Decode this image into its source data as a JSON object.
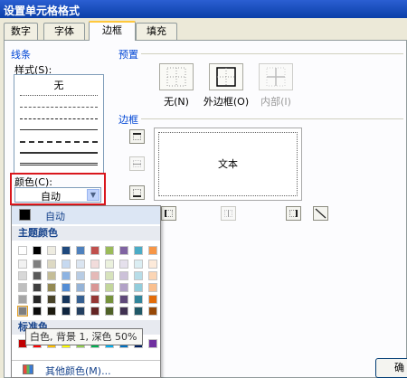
{
  "window": {
    "title": "设置单元格格式"
  },
  "tabs": [
    {
      "label": "数字",
      "active": false
    },
    {
      "label": "字体",
      "active": false
    },
    {
      "label": "边框",
      "active": true
    },
    {
      "label": "填充",
      "active": false
    }
  ],
  "line_section": {
    "label": "线条",
    "style_label": "样式(S):",
    "none_label": "无",
    "color_label": "颜色(C):",
    "color_value": "自动"
  },
  "preset_section": {
    "label": "预置",
    "buttons": [
      {
        "label": "无(N)",
        "icon": "no-border-icon",
        "enabled": true
      },
      {
        "label": "外边框(O)",
        "icon": "outline-border-icon",
        "enabled": true
      },
      {
        "label": "内部(I)",
        "icon": "inside-border-icon",
        "enabled": false
      }
    ]
  },
  "border_section": {
    "label": "边框",
    "preview_text": "文本"
  },
  "ok_button": "确",
  "color_palette": {
    "automatic_label": "自动",
    "automatic_color": "#000000",
    "theme_colors_label": "主题颜色",
    "theme_colors": [
      [
        "#FFFFFF",
        "#000000",
        "#EEECE1",
        "#1F497D",
        "#4F81BD",
        "#C0504D",
        "#9BBB59",
        "#8064A2",
        "#4BACC6",
        "#F79646"
      ],
      [
        "#F2F2F2",
        "#7F7F7F",
        "#DDD9C3",
        "#C6D9F0",
        "#DBE5F1",
        "#F2DCDB",
        "#EBF1DD",
        "#E5E0EC",
        "#DBEEF3",
        "#FDEADA"
      ],
      [
        "#D8D8D8",
        "#595959",
        "#C4BD97",
        "#8DB3E2",
        "#B8CCE4",
        "#E5B9B7",
        "#D7E3BC",
        "#CCC1D9",
        "#B7DDE8",
        "#FBD5B5"
      ],
      [
        "#BFBFBF",
        "#3F3F3F",
        "#938953",
        "#548DD4",
        "#95B3D7",
        "#D99694",
        "#C3D69B",
        "#B2A2C7",
        "#92CDDC",
        "#FAC08F"
      ],
      [
        "#A5A5A5",
        "#262626",
        "#494429",
        "#17365D",
        "#366092",
        "#953734",
        "#76923C",
        "#5F497A",
        "#31859B",
        "#E36C09"
      ],
      [
        "#7F7F7F",
        "#0C0C0C",
        "#1D1B10",
        "#0F243E",
        "#244061",
        "#632423",
        "#4F6128",
        "#3F3151",
        "#205867",
        "#974806"
      ]
    ],
    "selected_color": "#7F7F7F",
    "standard_colors_label": "标准色",
    "standard_colors": [
      "#C00000",
      "#FF0000",
      "#FFC000",
      "#FFFF00",
      "#92D050",
      "#00B050",
      "#00B0F0",
      "#0070C0",
      "#002060",
      "#7030A0"
    ],
    "more_colors_label": "其他颜色(M)...",
    "tooltip": "白色, 背景 1, 深色 50%"
  },
  "colors": {
    "highlight_red": "#D9171D",
    "group_label_blue": "#0046D5",
    "tab_active_accent": "#FFC83C"
  }
}
